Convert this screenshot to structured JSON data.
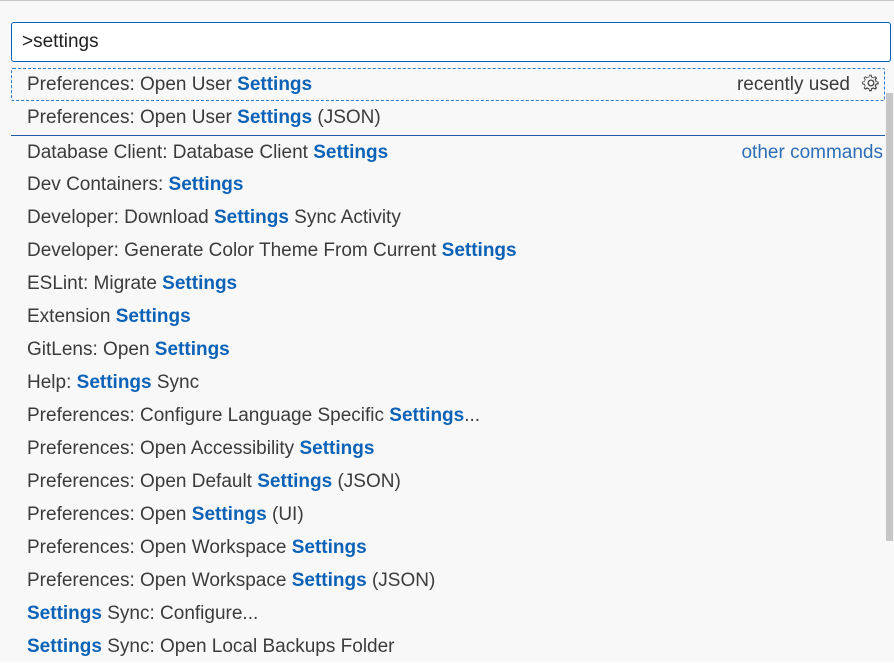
{
  "quick_input": {
    "value": ">settings",
    "placeholder": ""
  },
  "rows": [
    {
      "pre": "Preferences: Open User ",
      "hl": "Settings",
      "post": "",
      "right": "recently used",
      "focused": true,
      "gear": true
    },
    {
      "pre": "Preferences: Open User ",
      "hl": "Settings",
      "post": " (JSON)",
      "right": ""
    },
    {
      "pre": "Database Client: Database Client ",
      "hl": "Settings",
      "post": "",
      "right": "other commands"
    },
    {
      "pre": "Dev Containers: ",
      "hl": "Settings",
      "post": "",
      "right": ""
    },
    {
      "pre": "Developer: Download ",
      "hl": "Settings",
      "post": " Sync Activity",
      "right": ""
    },
    {
      "pre": "Developer: Generate Color Theme From Current ",
      "hl": "Settings",
      "post": "",
      "right": ""
    },
    {
      "pre": "ESLint: Migrate ",
      "hl": "Settings",
      "post": "",
      "right": ""
    },
    {
      "pre": "Extension ",
      "hl": "Settings",
      "post": "",
      "right": ""
    },
    {
      "pre": "GitLens: Open ",
      "hl": "Settings",
      "post": "",
      "right": ""
    },
    {
      "pre": "Help: ",
      "hl": "Settings",
      "post": " Sync",
      "right": ""
    },
    {
      "pre": "Preferences: Configure Language Specific ",
      "hl": "Settings",
      "post": "...",
      "right": ""
    },
    {
      "pre": "Preferences: Open Accessibility ",
      "hl": "Settings",
      "post": "",
      "right": ""
    },
    {
      "pre": "Preferences: Open Default ",
      "hl": "Settings",
      "post": " (JSON)",
      "right": ""
    },
    {
      "pre": "Preferences: Open ",
      "hl": "Settings",
      "post": " (UI)",
      "right": ""
    },
    {
      "pre": "Preferences: Open Workspace ",
      "hl": "Settings",
      "post": "",
      "right": ""
    },
    {
      "pre": "Preferences: Open Workspace ",
      "hl": "Settings",
      "post": " (JSON)",
      "right": ""
    },
    {
      "pre": "",
      "hl": "Settings",
      "post": " Sync: Configure...",
      "right": ""
    },
    {
      "pre": "",
      "hl": "Settings",
      "post": " Sync: Open Local Backups Folder",
      "right": ""
    }
  ],
  "icons": {
    "gear": "gear-icon"
  },
  "colors": {
    "highlight": "#0b62b7",
    "focus_border": "#2f78c4",
    "input_border": "#005fb8"
  }
}
